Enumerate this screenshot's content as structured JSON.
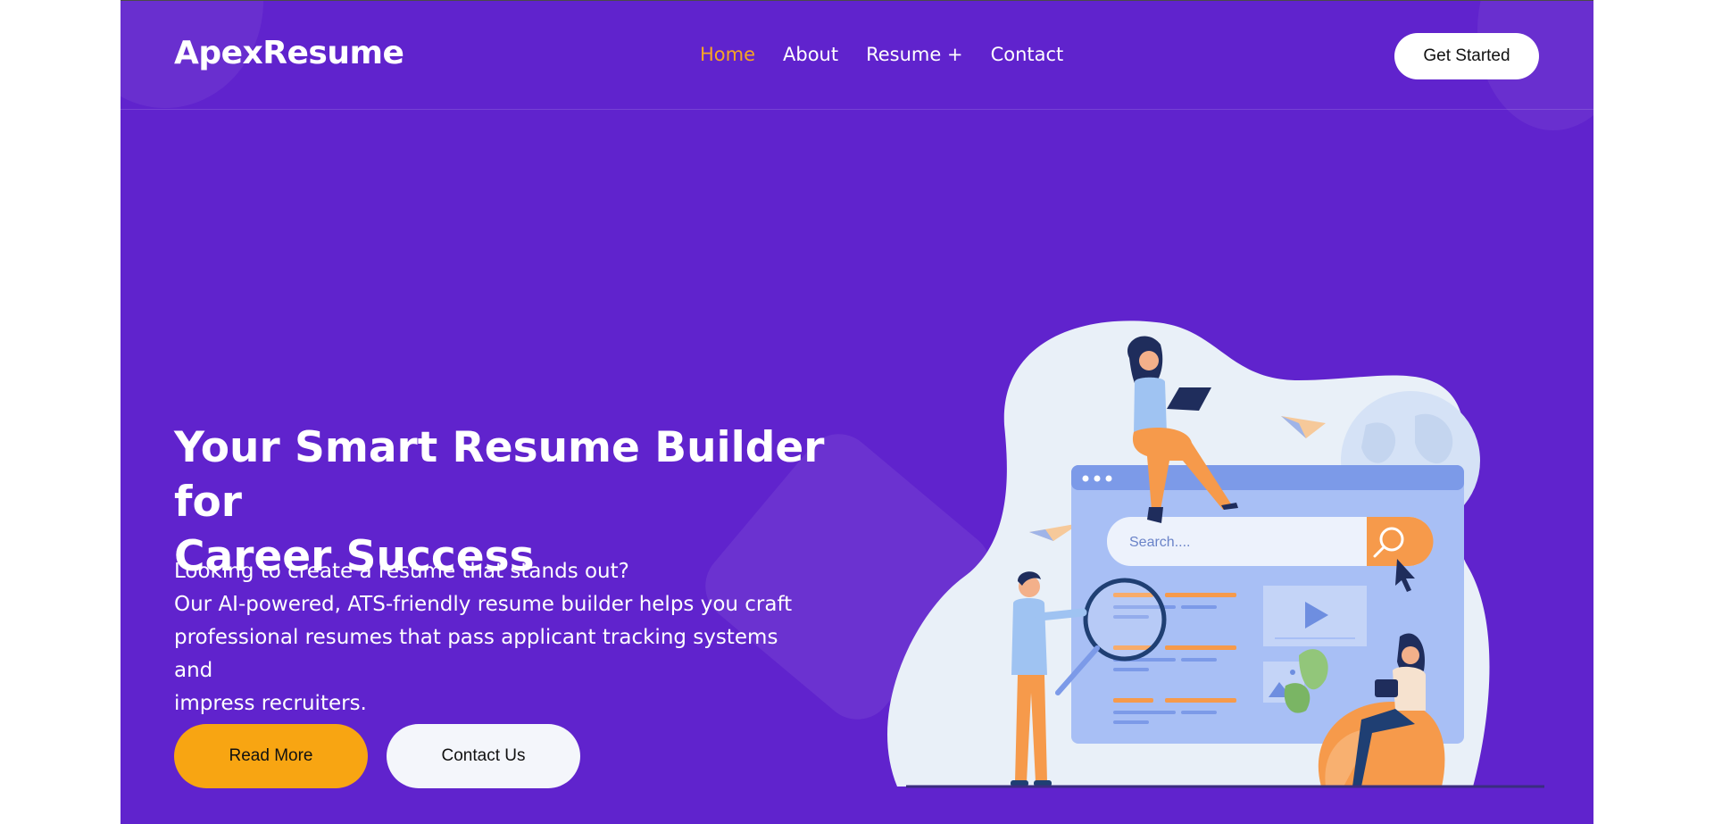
{
  "brand": {
    "name": "ApexResume"
  },
  "nav": {
    "items": [
      {
        "label": "Home",
        "active": true
      },
      {
        "label": "About",
        "active": false
      },
      {
        "label": "Resume +",
        "active": false
      },
      {
        "label": "Contact",
        "active": false
      }
    ],
    "cta_label": "Get Started"
  },
  "hero": {
    "title_line1": "Your Smart Resume Builder for",
    "title_line2": "Career Success",
    "lines": [
      "Looking to create a resume that stands out?",
      "Our AI-powered, ATS-friendly resume builder helps you craft",
      "professional resumes that pass applicant tracking systems and",
      "impress recruiters."
    ],
    "read_more_label": "Read More",
    "contact_label": "Contact Us"
  },
  "illustration": {
    "search_placeholder": "Search...."
  },
  "colors": {
    "background": "#6023cd",
    "accent": "#f6a623",
    "button_primary": "#f8a512",
    "button_secondary": "#f4f6fb"
  }
}
